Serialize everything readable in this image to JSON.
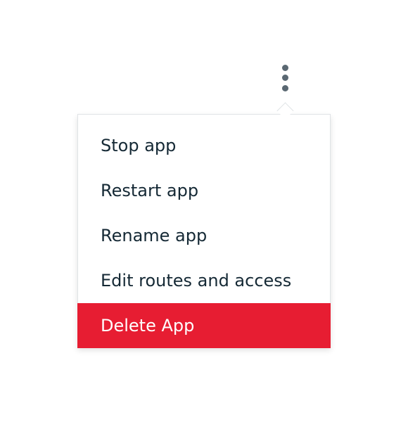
{
  "overflow_menu": {
    "trigger_icon": "overflow-vertical-icon",
    "items": [
      {
        "label": "Stop app"
      },
      {
        "label": "Restart app"
      },
      {
        "label": "Rename app"
      },
      {
        "label": "Edit routes and access"
      },
      {
        "label": "Delete App",
        "variant": "danger"
      }
    ],
    "colors": {
      "danger_background": "#e71d32",
      "danger_text": "#ffffff",
      "text": "#152935",
      "icon": "#5a6872"
    }
  }
}
